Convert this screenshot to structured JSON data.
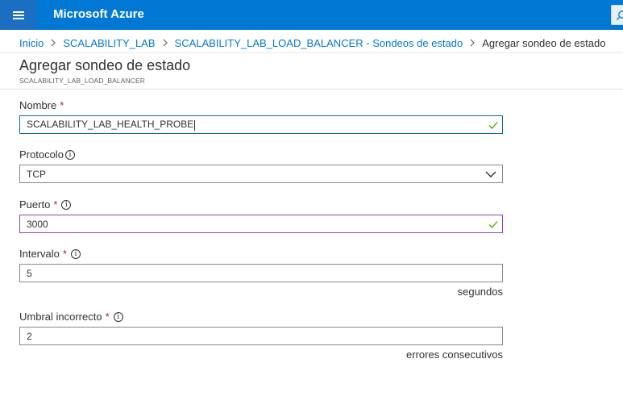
{
  "topbar": {
    "brand": "Microsoft Azure",
    "accent_color": "#0078d4",
    "menu_icon": "hamburger-icon",
    "search_icon": "search-icon"
  },
  "breadcrumb": {
    "items": [
      {
        "label": "Inicio"
      },
      {
        "label": "SCALABILITY_LAB"
      },
      {
        "label": "SCALABILITY_LAB_LOAD_BALANCER - Sondeos de estado"
      },
      {
        "label": "Agregar sondeo de estado"
      }
    ]
  },
  "page": {
    "title": "Agregar sondeo de estado",
    "subtitle": "SCALABILITY_LAB_LOAD_BALANCER"
  },
  "form": {
    "name": {
      "label": "Nombre",
      "required": "*",
      "value": "SCALABILITY_LAB_HEALTH_PROBE"
    },
    "protocol": {
      "label": "Protocolo",
      "value": "TCP"
    },
    "port": {
      "label": "Puerto",
      "required": "*",
      "value": "3000"
    },
    "interval": {
      "label": "Intervalo",
      "required": "*",
      "value": "5",
      "unit": "segundos"
    },
    "threshold": {
      "label": "Umbral incorrecto",
      "required": "*",
      "value": "2",
      "unit": "errores consecutivos"
    }
  }
}
